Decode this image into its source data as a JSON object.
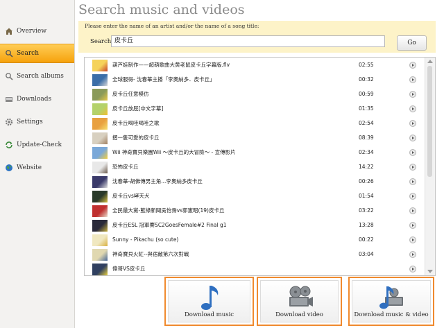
{
  "sidebar": {
    "items": [
      {
        "label": "Overview",
        "icon": "home-icon"
      },
      {
        "label": "Search",
        "icon": "search-icon",
        "active": true
      },
      {
        "label": "Search albums",
        "icon": "search-albums-icon"
      },
      {
        "label": "Downloads",
        "icon": "downloads-icon"
      },
      {
        "label": "Settings",
        "icon": "gear-icon"
      },
      {
        "label": "Update-Check",
        "icon": "refresh-icon"
      },
      {
        "label": "Website",
        "icon": "globe-icon"
      }
    ]
  },
  "main": {
    "title": "Search music and videos",
    "instruction": "Please enter the name of an artist and/or the name of a song title:",
    "search_label": "Search:",
    "search_value": "皮卡丘",
    "go_label": "Go"
  },
  "results": [
    {
      "title": "葫芦娃制作——超萌歌曲大黄老鼠皮卡丘字幕版.flv",
      "duration": "02:55"
    },
    {
      "title": "全球服得- 沈春華主播「李奧納多．皮卡丘」",
      "duration": "00:32"
    },
    {
      "title": "皮卡丘任意模仿",
      "duration": "00:59"
    },
    {
      "title": "皮卡丘放屁[中文字幕]",
      "duration": "01:35"
    },
    {
      "title": "皮卡丘喝哇喝哇之歌",
      "duration": "02:54"
    },
    {
      "title": "摺一隻可愛的皮卡丘",
      "duration": "08:39"
    },
    {
      "title": "Wii 神奇寶貝樂園Wii ～皮卡丘的大冒險～ - 宣傳影片",
      "duration": "02:34"
    },
    {
      "title": "恐怖皮卡丘",
      "duration": "14:22"
    },
    {
      "title": "沈春華-胡佛傳男主角...李奧納多皮卡丘",
      "duration": "00:26"
    },
    {
      "title": "皮卡丘vs哮天犬",
      "duration": "01:54"
    },
    {
      "title": "全民最大黨-藍綠新聞吳怡霈vs郭憲昭(19)皮卡丘",
      "duration": "03:22"
    },
    {
      "title": "皮卡丘ESL 冠軍賽SC2GoesFemale#2 Final g1",
      "duration": "13:28"
    },
    {
      "title": "Sunny - Pikachu (so cute)",
      "duration": "00:22"
    },
    {
      "title": "神奇寶貝火紅--與宿敵第六次對戰",
      "duration": "03:04"
    },
    {
      "title": "偉哥VS皮卡丘",
      "duration": ""
    }
  ],
  "downloads": {
    "music_label": "Download music",
    "video_label": "Download video",
    "both_label": "Download music & video"
  },
  "colors": {
    "active_nav": "#f6a20c",
    "panel_bg": "#fdf3c8",
    "button_border": "#f08a2e",
    "note_blue": "#2f6fc0"
  }
}
